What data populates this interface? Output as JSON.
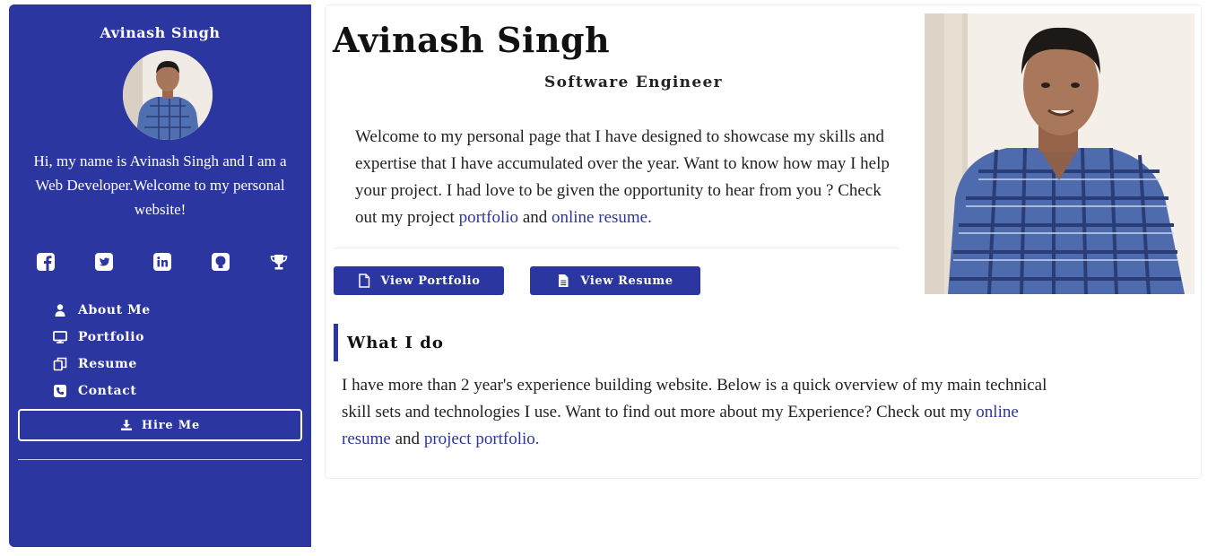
{
  "sidebar": {
    "name": "Avinash Singh",
    "intro": "Hi, my name is Avinash Singh and I am a Web Developer.Welcome to my personal website!",
    "socials": [
      {
        "icon": "facebook-icon"
      },
      {
        "icon": "twitter-icon"
      },
      {
        "icon": "linkedin-icon"
      },
      {
        "icon": "github-icon"
      },
      {
        "icon": "trophy-icon"
      }
    ],
    "nav": [
      {
        "label": "About Me",
        "icon": "user-icon"
      },
      {
        "label": "Portfolio",
        "icon": "desktop-icon"
      },
      {
        "label": "Resume",
        "icon": "copy-icon"
      },
      {
        "label": "Contact",
        "icon": "phone-icon"
      }
    ],
    "hire_label": "Hire Me",
    "accent": "#2c36a1"
  },
  "hero": {
    "name": "Avinash Singh",
    "title": "Software Engineer",
    "welcome_text": "Welcome to my personal page that I have designed to showcase my skills and expertise that I have accumulated over the year. Want to know how may I help your project. I had love to be given the opportunity to hear from you ? Check out my project ",
    "portfolio_link": "portfolio",
    "and_text": " and ",
    "resume_link": "online resume.",
    "view_portfolio": "View Portfolio",
    "view_resume": "View Resume"
  },
  "what_i_do": {
    "heading": "What I do",
    "text": "I have more than 2 year's experience building website. Below is a quick overview of my main technical skill sets and technologies I use. Want to find out more about my Experience? Check out my ",
    "resume_link": "online resume",
    "and_text": " and ",
    "portfolio_link": "project portfolio."
  }
}
